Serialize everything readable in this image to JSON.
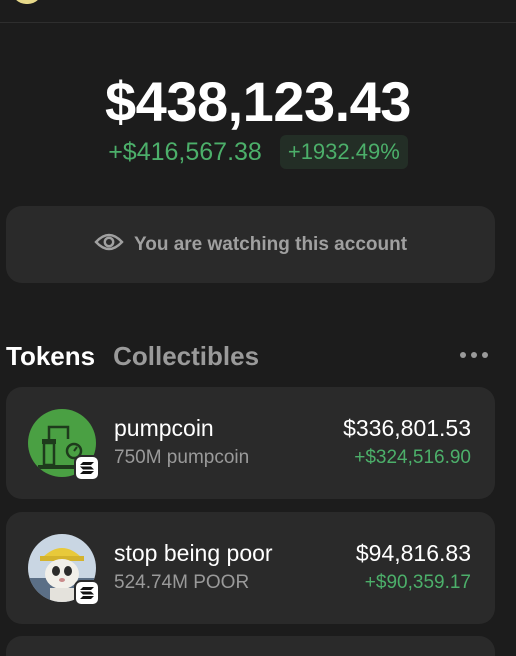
{
  "portfolio": {
    "balance": "$438,123.43",
    "change_abs": "+$416,567.38",
    "change_pct": "+1932.49%"
  },
  "watch_notice": {
    "icon": "eye-icon",
    "text": "You are watching this account"
  },
  "tabs": {
    "tokens": "Tokens",
    "collectibles": "Collectibles",
    "more_icon": "more-dots-icon"
  },
  "tokens": [
    {
      "name": "pumpcoin",
      "amount": "750M pumpcoin",
      "value": "$336,801.53",
      "change": "+$324,516.90",
      "icon": "pumpcoin-icon",
      "badge": "solana-icon"
    },
    {
      "name": "stop being poor",
      "amount": "524.74M POOR",
      "value": "$94,816.83",
      "change": "+$90,359.17",
      "icon": "poor-token-icon",
      "badge": "solana-icon"
    }
  ],
  "colors": {
    "background": "#1c1c1c",
    "card": "#2a2a2a",
    "positive": "#4caf6a",
    "muted": "#9a9a9a"
  }
}
